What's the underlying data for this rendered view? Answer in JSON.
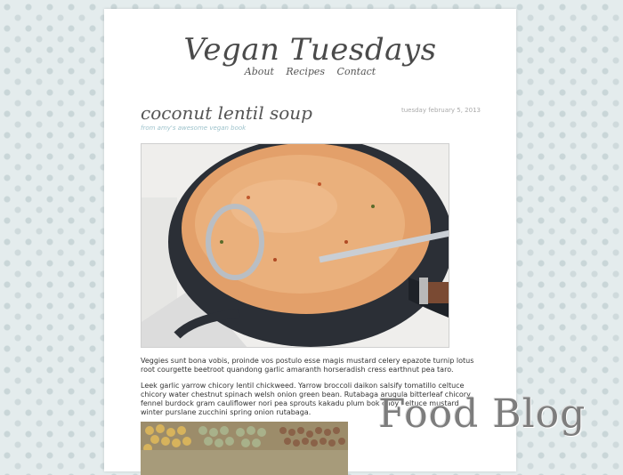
{
  "site": {
    "title": "Vegan Tuesdays"
  },
  "nav": {
    "items": [
      "About",
      "Recipes",
      "Contact"
    ]
  },
  "post": {
    "title": "coconut lentil soup",
    "date": "tuesday february 5, 2013",
    "source": "from amy's awesome vegan book",
    "paragraphs": [
      "Veggies sunt bona vobis, proinde vos postulo esse magis mustard celery epazote turnip lotus root courgette beetroot quandong garlic amaranth horseradish cress earthnut pea taro.",
      "Leek garlic yarrow chicory lentil chickweed. Yarrow broccoli daikon salsify tomatillo celtuce chicory water chestnut spinach welsh onion green bean. Rutabaga arugula bitterleaf chicory fennel burdock gram cauliflower nori pea sprouts kakadu plum bok choy celtuce mustard winter purslane zucchini spring onion rutabaga."
    ]
  },
  "watermark": {
    "text": "Food Blog"
  },
  "colors": {
    "background": "#e4eced",
    "accent": "#9ec3cc",
    "text": "#333333"
  }
}
